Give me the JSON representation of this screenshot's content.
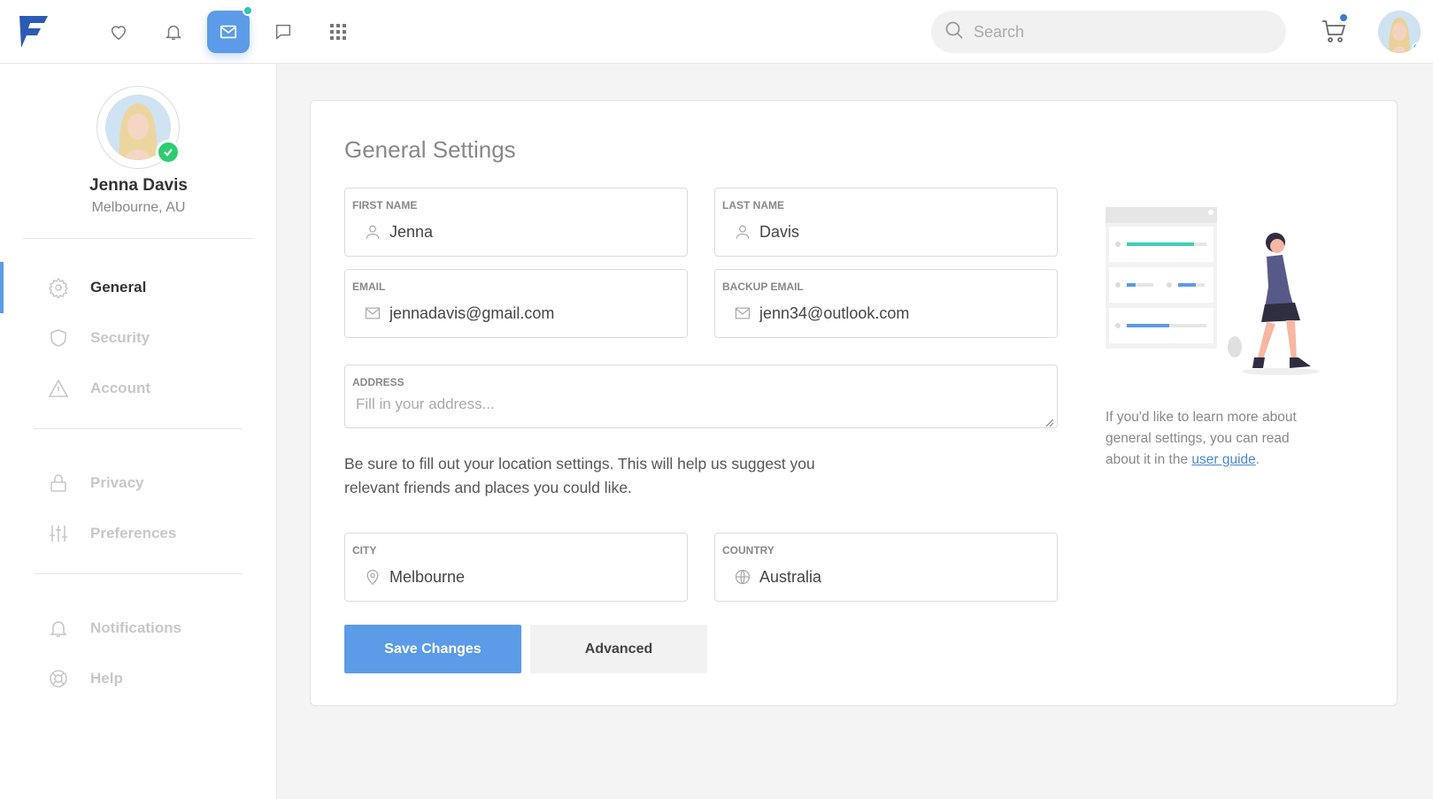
{
  "topbar": {
    "nav_icons": [
      "heart-icon",
      "bell-icon",
      "mail-icon",
      "chat-icon",
      "grid-icon"
    ],
    "active_icon": "mail-icon",
    "search_placeholder": "Search",
    "accent": "#5b9be8",
    "notification_dot": "#2ec4b6",
    "cart_dot": "#3a7bd5"
  },
  "profile": {
    "name": "Jenna Davis",
    "location": "Melbourne, AU"
  },
  "sidebar": {
    "items": [
      {
        "label": "General",
        "icon": "gear-icon",
        "active": true
      },
      {
        "label": "Security",
        "icon": "shield-icon"
      },
      {
        "label": "Account",
        "icon": "warning-icon"
      },
      {
        "label": "Privacy",
        "icon": "lock-icon"
      },
      {
        "label": "Preferences",
        "icon": "sliders-icon"
      },
      {
        "label": "Notifications",
        "icon": "bell-icon"
      },
      {
        "label": "Help",
        "icon": "lifebuoy-icon"
      }
    ]
  },
  "form": {
    "title": "General Settings",
    "first_name": {
      "label": "First Name",
      "value": "Jenna"
    },
    "last_name": {
      "label": "Last Name",
      "value": "Davis"
    },
    "email": {
      "label": "Email",
      "value": "jennadavis@gmail.com"
    },
    "backup_email": {
      "label": "Backup Email",
      "value": "jenn34@outlook.com"
    },
    "address": {
      "label": "Address",
      "placeholder": "Fill in your address..."
    },
    "note": "Be sure to fill out your location settings. This will help us suggest you relevant friends and places you could like.",
    "city": {
      "label": "City",
      "value": "Melbourne"
    },
    "country": {
      "label": "Country",
      "value": "Australia"
    },
    "save_label": "Save Changes",
    "advanced_label": "Advanced"
  },
  "help": {
    "text": "If you'd like to learn more about general settings, you can read about it in the",
    "link": "user guide",
    "end": "."
  }
}
